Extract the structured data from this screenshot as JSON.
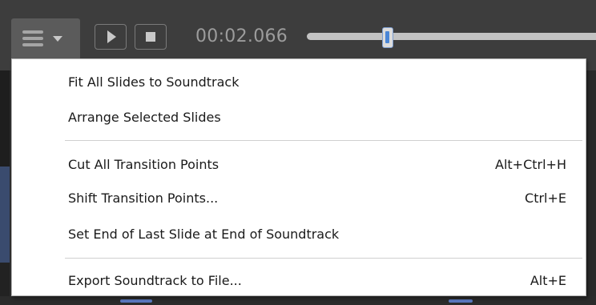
{
  "player": {
    "time": "00:02.066",
    "seek_progress": 0.28
  },
  "menu": {
    "items": [
      {
        "label": "Fit All Slides to Soundtrack",
        "shortcut": ""
      },
      {
        "label": "Arrange Selected Slides",
        "shortcut": ""
      },
      {
        "label": "Cut All Transition Points",
        "shortcut": "Alt+Ctrl+H"
      },
      {
        "label": "Shift Transition Points...",
        "shortcut": "Ctrl+E"
      },
      {
        "label": "Set End of Last Slide at End of Soundtrack",
        "shortcut": ""
      },
      {
        "label": "Export Soundtrack to File...",
        "shortcut": "Alt+E"
      }
    ]
  },
  "icons": {
    "menu": "hamburger-menu-icon",
    "dropdown": "chevron-down-icon",
    "play": "play-icon",
    "stop": "stop-icon"
  },
  "colors": {
    "toolbar_bg": "#3d3d3d",
    "menu_button_bg": "#5b5b5b",
    "seek_thumb_accent": "#4a86d6",
    "menu_bg": "#ffffff"
  }
}
